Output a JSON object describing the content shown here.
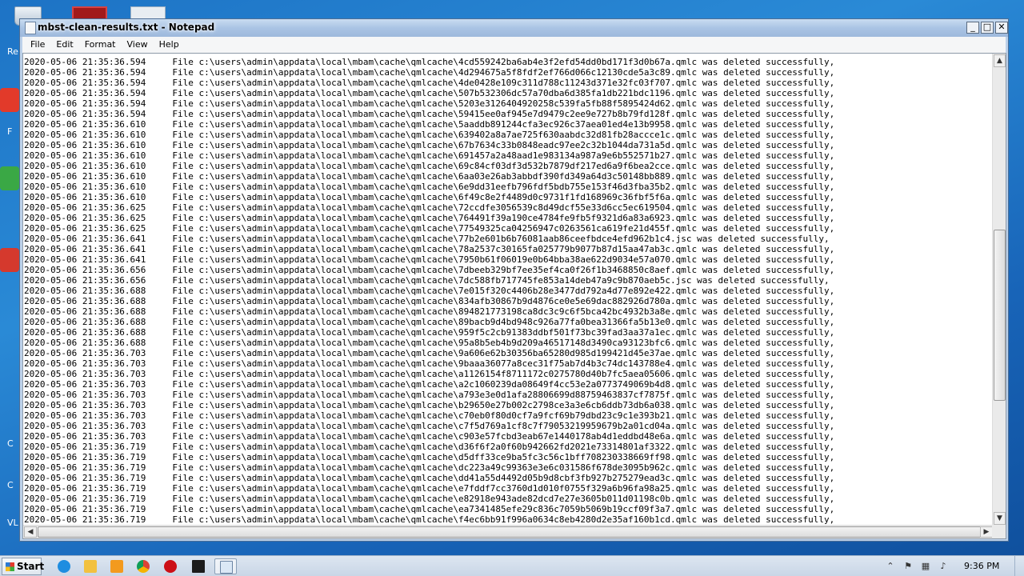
{
  "window": {
    "title": "mbst-clean-results.txt - Notepad",
    "menu": [
      "File",
      "Edit",
      "Format",
      "View",
      "Help"
    ]
  },
  "desktop": {
    "labels": [
      "Re",
      "F",
      "C",
      "C",
      "VL"
    ]
  },
  "log": {
    "prefix": "File c:\\users\\admin\\appdata\\local\\mbam\\cache\\qmlcache\\",
    "suffix_ok": " was deleted successfully,",
    "lines": [
      [
        "2020-05-06 21:35:36.594",
        "4cd559242ba6ab4e3f2efd54dd0bd171f3d0b67a.qmlc"
      ],
      [
        "2020-05-06 21:35:36.594",
        "4d294675a5f8fdf2ef766d066c12130cde5a3c89.qmlc"
      ],
      [
        "2020-05-06 21:35:36.594",
        "4de0428e109c311d788c11243d371e32fc03f707.qmlc"
      ],
      [
        "2020-05-06 21:35:36.594",
        "507b532306dc57a70dba6d385fa1db221bdc1196.qmlc"
      ],
      [
        "2020-05-06 21:35:36.594",
        "5203e3126404920258c539fa5fb88f5895424d62.qmlc"
      ],
      [
        "2020-05-06 21:35:36.594",
        "59415ee0af945e7d9479c2ee9e727b8b79fd128f.qmlc"
      ],
      [
        "2020-05-06 21:35:36.610",
        "5aaddb891244cfa3ec926c37aea01ed4e13b9958.qmlc"
      ],
      [
        "2020-05-06 21:35:36.610",
        "639402a8a7ae725f630aabdc32d81fb28accce1c.qmlc"
      ],
      [
        "2020-05-06 21:35:36.610",
        "67b7634c33b0848eadc97ee2c32b1044da731a5d.qmlc"
      ],
      [
        "2020-05-06 21:35:36.610",
        "691457a2a48aad1e983134a987a9e6b552571b27.qmlc"
      ],
      [
        "2020-05-06 21:35:36.610",
        "69c84cf03df3d532b7879df217ed6a9f6bea2cce.qmlc"
      ],
      [
        "2020-05-06 21:35:36.610",
        "6aa03e26ab3abbdf390fd349a64d3c50148bb889.qmlc"
      ],
      [
        "2020-05-06 21:35:36.610",
        "6e9dd31eefb796fdf5bdb755e153f46d3fba35b2.qmlc"
      ],
      [
        "2020-05-06 21:35:36.610",
        "6f49c8e2f4489d0c9731f1fd168969c36fbf5f6a.qmlc"
      ],
      [
        "2020-05-06 21:35:36.625",
        "72ccdfe3056539c8d49dcf55e33d6cc5ec619504.qmlc"
      ],
      [
        "2020-05-06 21:35:36.625",
        "764491f39a190ce4784fe9fb5f9321d6a83a6923.qmlc"
      ],
      [
        "2020-05-06 21:35:36.625",
        "77549325ca04256947c0263561ca619fe21d455f.qmlc"
      ],
      [
        "2020-05-06 21:35:36.641",
        "77b2e601b6b76081aab86ceefbdce4efd962b1c4.jsc"
      ],
      [
        "2020-05-06 21:35:36.641",
        "78a2537c30165fa025779b9077b87d15aa47ab3c.qmlc"
      ],
      [
        "2020-05-06 21:35:36.641",
        "7950b61f06019e0b64bba38ae622d9034e57a070.qmlc"
      ],
      [
        "2020-05-06 21:35:36.656",
        "7dbeeb329bf7ee35ef4ca0f26f1b3468850c8aef.qmlc"
      ],
      [
        "2020-05-06 21:35:36.656",
        "7dc588fb717745fe853a14deb47a9c9b870aeb5c.jsc"
      ],
      [
        "2020-05-06 21:35:36.688",
        "7e015f320c4406b28e3477dd792a4d77e892e422.qmlc"
      ],
      [
        "2020-05-06 21:35:36.688",
        "834afb30867b9d4876ce0e5e69dac882926d780a.qmlc"
      ],
      [
        "2020-05-06 21:35:36.688",
        "894821773198ca8dc3c9c6f5bca42bc4932b3a8e.qmlc"
      ],
      [
        "2020-05-06 21:35:36.688",
        "89bacb9d4bd948c926a77fa0bea31366fa5b13e0.qmlc"
      ],
      [
        "2020-05-06 21:35:36.688",
        "959f5c2cb91383ddbf501f73bc39fad3aa37a1ec.qmlc"
      ],
      [
        "2020-05-06 21:35:36.688",
        "95a8b5eb4b9d209a46517148d3490ca93123bfc6.qmlc"
      ],
      [
        "2020-05-06 21:35:36.703",
        "9a606e62b30356ba65280d985d199421d45e37ae.qmlc"
      ],
      [
        "2020-05-06 21:35:36.703",
        "9baaa36077a8cec31f75ab7d4b3c74dc143788e4.qmlc"
      ],
      [
        "2020-05-06 21:35:36.703",
        "a1126154f8711172c0275780d40b7fc5aea05606.qmlc"
      ],
      [
        "2020-05-06 21:35:36.703",
        "a2c1060239da08649f4cc53e2a0773749069b4d8.qmlc"
      ],
      [
        "2020-05-06 21:35:36.703",
        "a793e3e0d1afa28806699d88759463837cf7875f.qmlc"
      ],
      [
        "2020-05-06 21:35:36.703",
        "b29650e27b002c2798ce3a3e6cb6ddb73db6a038.qmlc"
      ],
      [
        "2020-05-06 21:35:36.703",
        "c70eb0f80d0cf7a9fcf69b79dbd23c9c1e393b21.qmlc"
      ],
      [
        "2020-05-06 21:35:36.703",
        "c7f5d769a1cf8c7f79053219959679b2a01cd04a.qmlc"
      ],
      [
        "2020-05-06 21:35:36.703",
        "c903e57fcbd3eab67e1440178ab4d1eddbd48e6a.qmlc"
      ],
      [
        "2020-05-06 21:35:36.719",
        "d36f6f2a0f60b942662fd2021e73314801af3322.qmlc"
      ],
      [
        "2020-05-06 21:35:36.719",
        "d5dff33ce9ba5fc3c56c1bff708230338669ff98.qmlc"
      ],
      [
        "2020-05-06 21:35:36.719",
        "dc223a49c99363e3e6c031586f678de3095b962c.qmlc"
      ],
      [
        "2020-05-06 21:35:36.719",
        "dd41a55d4492d05b9d8cbf3fb927b275279ead3c.qmlc"
      ],
      [
        "2020-05-06 21:35:36.719",
        "e7fddf7cc3760d1d010f0755f329a6b96fa98a25.qmlc"
      ],
      [
        "2020-05-06 21:35:36.719",
        "e82918e943ade82dcd7e27e3605b011d01198c0b.qmlc"
      ],
      [
        "2020-05-06 21:35:36.719",
        "ea7341485efe29c836c7059b5069b19ccf09f3a7.qmlc"
      ],
      [
        "2020-05-06 21:35:36.719",
        "f4ec6bb91f996a0634c8eb4280d2e35af160b1cd.qmlc"
      ]
    ]
  },
  "taskbar": {
    "start_label": "Start",
    "clock": "9:36 PM"
  }
}
